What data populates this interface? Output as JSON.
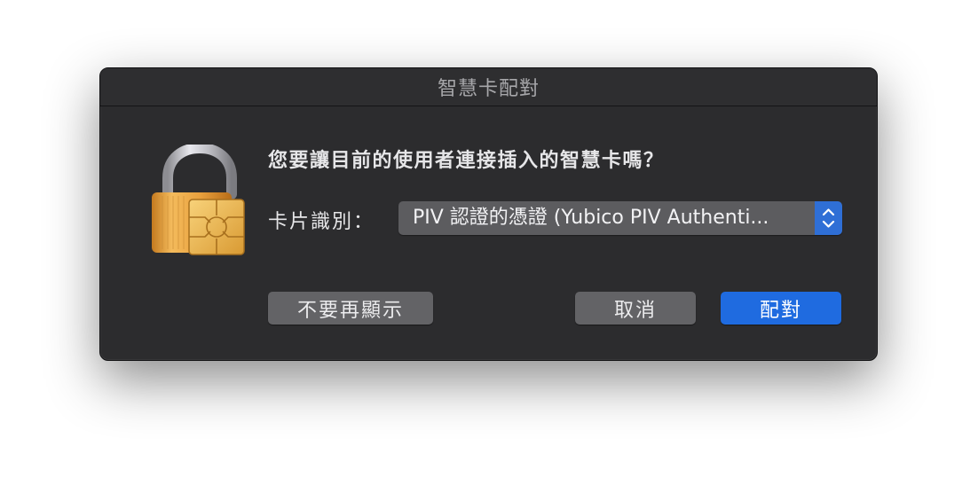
{
  "dialog": {
    "title": "智慧卡配對",
    "question": "您要讓目前的使用者連接插入的智慧卡嗎？",
    "card_id_label": "卡片識別：",
    "card_id_value": "PIV 認證的憑證 (Yubico PIV Authenti...",
    "buttons": {
      "dont_show": "不要再顯示",
      "cancel": "取消",
      "pair": "配對"
    }
  },
  "icons": {
    "lock": "padlock-with-smartcard-chip-icon",
    "popup_arrows": "up-down-chevron-icon"
  },
  "colors": {
    "dialog_bg": "#2c2c2e",
    "primary_button": "#1f6be0",
    "secondary_button": "#636366",
    "popup_bg": "#5c5c5f",
    "stepper_bg": "#2f6fd6",
    "lock_gold": "#e6a23c",
    "text": "#e6e6e8"
  }
}
